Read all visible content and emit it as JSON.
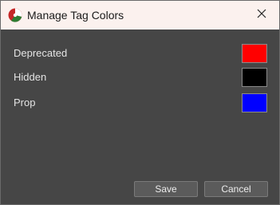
{
  "window": {
    "title": "Manage Tag Colors"
  },
  "tags": [
    {
      "label": "Deprecated",
      "color": "#ff0000"
    },
    {
      "label": "Hidden",
      "color": "#000000"
    },
    {
      "label": "Prop",
      "color": "#0000ff"
    }
  ],
  "buttons": {
    "save_label": "Save",
    "cancel_label": "Cancel"
  },
  "icons": {
    "app": "app-logo-icon",
    "close": "close-icon"
  }
}
